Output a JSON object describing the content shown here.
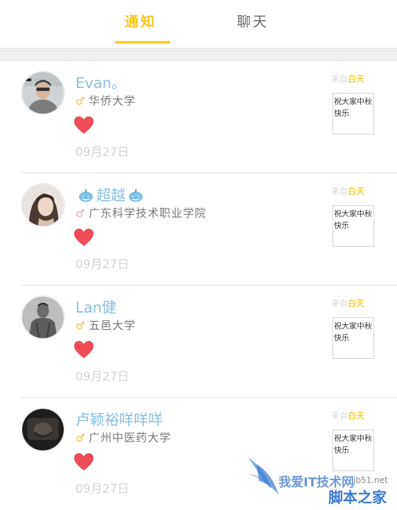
{
  "tabs": [
    {
      "label": "通知",
      "active": true
    },
    {
      "label": "聊天",
      "active": false
    }
  ],
  "notifications": [
    {
      "name": "Evan。",
      "gender_symbol": "♂",
      "gender": "male",
      "school": "华侨大学",
      "date": "09月27日",
      "source_prefix": "来自",
      "source_app": "白天",
      "card_text": "祝大家中秋快乐",
      "name_decor": false
    },
    {
      "name": "超越",
      "gender_symbol": "♂",
      "gender": "female",
      "school": "广东科学技术职业学院",
      "date": "09月27日",
      "source_prefix": "来自",
      "source_app": "白天",
      "card_text": "祝大家中秋快乐",
      "name_decor": true
    },
    {
      "name": "Lan健",
      "gender_symbol": "♂",
      "gender": "male",
      "school": "五邑大学",
      "date": "09月27日",
      "source_prefix": "来自",
      "source_app": "白天",
      "card_text": "祝大家中秋快乐",
      "name_decor": false
    },
    {
      "name": "卢颖裕咩咩咩",
      "gender_symbol": "♂",
      "gender": "male",
      "school": "广州中医药大学",
      "date": "09月27日",
      "source_prefix": "来自",
      "source_app": "白天",
      "card_text": "祝大家中秋快乐",
      "name_decor": false
    }
  ],
  "watermark": {
    "line1": "我爱IT技术网",
    "site": "jb51.net",
    "line2": "脚本之家"
  },
  "colors": {
    "accent": "#f5cf26",
    "name": "#87bfe0",
    "heart": "#ee4c57",
    "date": "#d4d4d4"
  }
}
